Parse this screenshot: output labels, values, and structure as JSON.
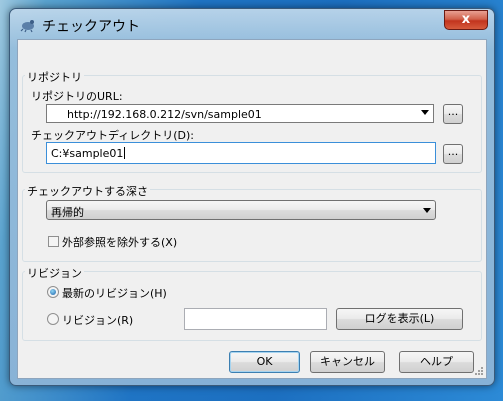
{
  "window": {
    "title": "チェックアウト",
    "close_label": "x"
  },
  "repository": {
    "group_label": "リポジトリ",
    "url_label": "リポジトリのURL:",
    "url_value": "http://192.168.0.212/svn/sample01",
    "checkout_dir_label": "チェックアウトディレクトリ(D):",
    "checkout_dir_value": "C:¥sample01",
    "browse_label": "..."
  },
  "depth": {
    "group_label": "チェックアウトする深さ",
    "selected": "再帰的",
    "externals_label": "外部参照を除外する(X)",
    "externals_checked": false
  },
  "revision": {
    "group_label": "リビジョン",
    "latest_label": "最新のリビジョン(H)",
    "specific_label": "リビジョン(R)",
    "specific_value": "",
    "show_log_label": "ログを表示(L)",
    "selected": "latest"
  },
  "buttons": {
    "ok": "OK",
    "cancel": "キャンセル",
    "help": "ヘルプ"
  }
}
